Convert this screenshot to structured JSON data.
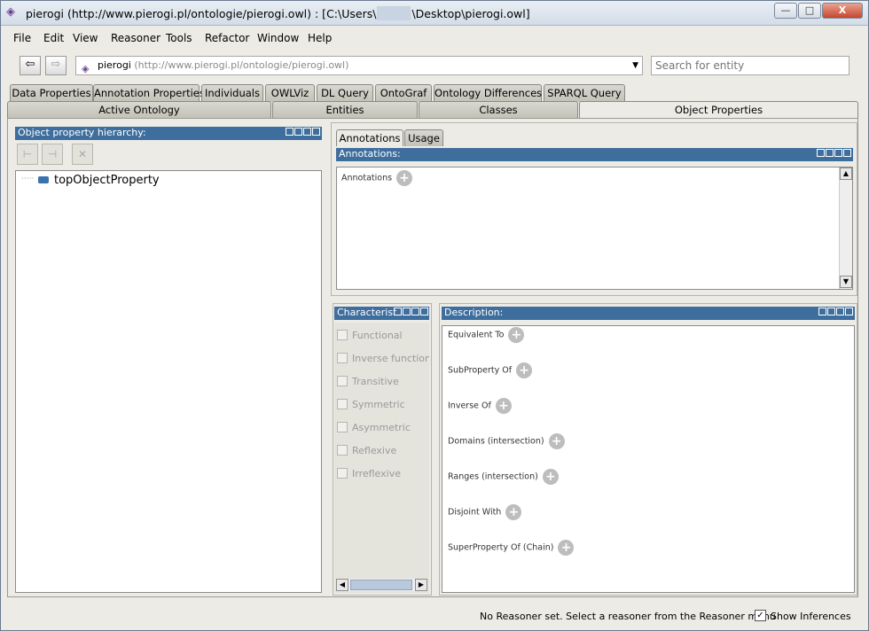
{
  "window": {
    "title_prefix": "pierogi (http://www.pierogi.pl/ontologie/pierogi.owl)  : [C:\\Users\\",
    "title_suffix": "\\Desktop\\pierogi.owl]",
    "minimize": "—",
    "maximize": "□",
    "close": "X"
  },
  "menu": [
    "File",
    "Edit",
    "View",
    "Reasoner",
    "Tools",
    "Refactor",
    "Window",
    "Help"
  ],
  "nav": {
    "back_icon": "arrow-left-icon",
    "forward_icon": "arrow-right-icon",
    "back": "⇦",
    "forward": "⇨",
    "ontology_name": "pierogi",
    "ontology_iri": "(http://www.pierogi.pl/ontologie/pierogi.owl)",
    "search_placeholder": "Search for entity"
  },
  "tabs_top": [
    "Data Properties",
    "Annotation Properties",
    "Individuals",
    "OWLViz",
    "DL Query",
    "OntoGraf",
    "Ontology Differences",
    "SPARQL Query"
  ],
  "tabs_main": [
    "Active Ontology",
    "Entities",
    "Classes",
    "Object Properties"
  ],
  "hierarchy": {
    "title": "Object property hierarchy:",
    "root": "topObjectProperty",
    "tree_prefix": "·····"
  },
  "annotations": {
    "subtabs": [
      "Annotations",
      "Usage"
    ],
    "title": "Annotations:",
    "label": "Annotations"
  },
  "characteristics": {
    "title": "Characterist",
    "items": [
      "Functional",
      "Inverse functional",
      "Transitive",
      "Symmetric",
      "Asymmetric",
      "Reflexive",
      "Irreflexive"
    ]
  },
  "description": {
    "title": "Description:",
    "sections": [
      "Equivalent To",
      "SubProperty Of",
      "Inverse Of",
      "Domains (intersection)",
      "Ranges (intersection)",
      "Disjoint With",
      "SuperProperty Of (Chain)"
    ]
  },
  "status": {
    "message": "No Reasoner set. Select a reasoner from the Reasoner menu",
    "show_inferences": "Show Inferences",
    "show_inferences_checked": true,
    "check_glyph": "✓"
  },
  "glyphs": {
    "plus": "+",
    "up": "▲",
    "down": "▼",
    "left": "◀",
    "right": "▶",
    "combo_arrow": "▼",
    "onto_icon": "◈",
    "tool_add_sub": "⊢",
    "tool_add_sib": "⊣",
    "tool_delete": "✕"
  },
  "colors": {
    "panel_title": "#3e6e9e",
    "window_bg": "#ecebe6"
  }
}
